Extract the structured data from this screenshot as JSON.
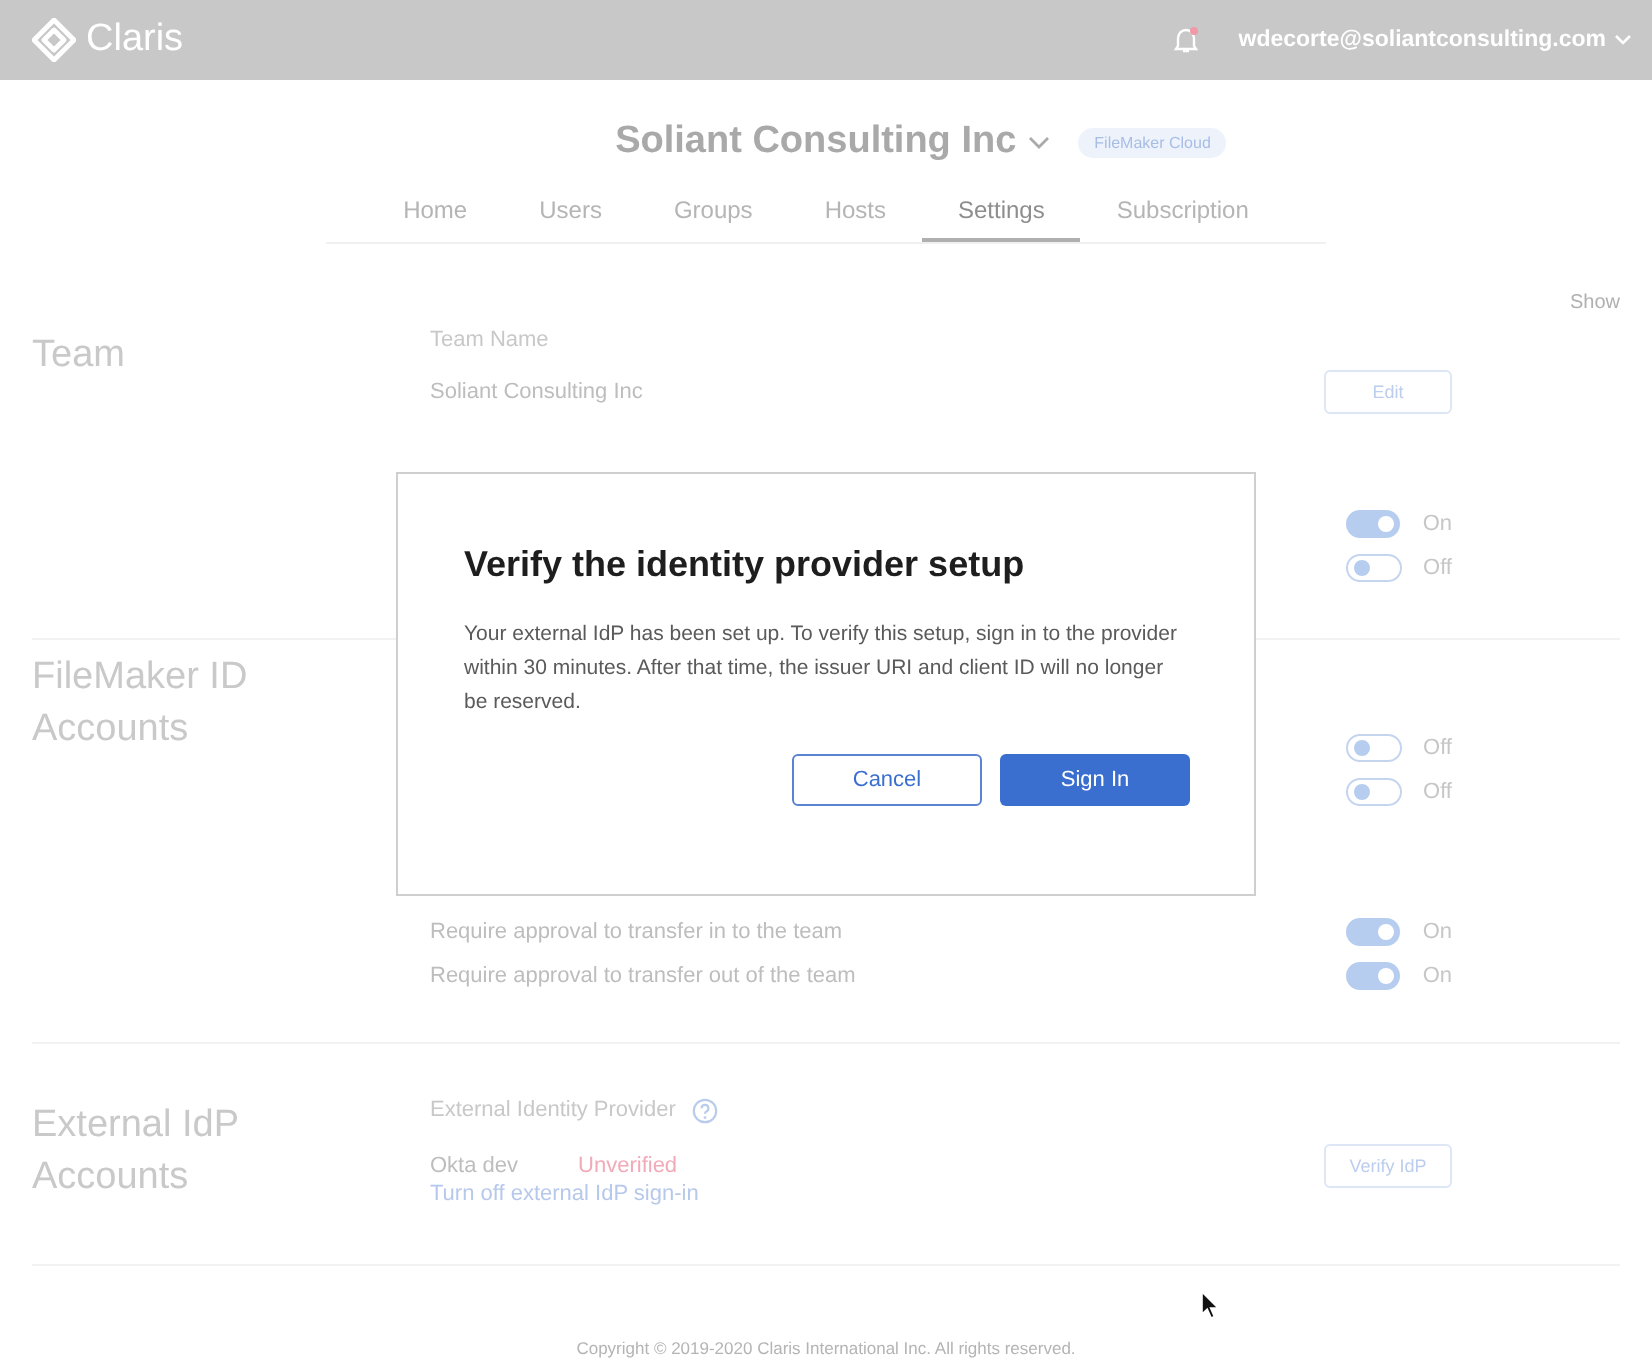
{
  "header": {
    "logo": "Claris",
    "user": "wdecorte@soliantconsulting.com"
  },
  "org": {
    "name": "Soliant Consulting Inc",
    "badge": "FileMaker Cloud"
  },
  "tabs": [
    {
      "label": "Home",
      "selected": false
    },
    {
      "label": "Users",
      "selected": false
    },
    {
      "label": "Groups",
      "selected": false
    },
    {
      "label": "Hosts",
      "selected": false
    },
    {
      "label": "Settings",
      "selected": true
    },
    {
      "label": "Subscription",
      "selected": false
    }
  ],
  "show_link": "Show",
  "sections": [
    {
      "title": "Team",
      "groups": [
        [
          {
            "kind": "label",
            "text": "Team Name"
          },
          {
            "kind": "value",
            "text": "Soliant Consulting Inc",
            "button": "Edit"
          }
        ],
        [
          {
            "kind": "toggle",
            "on": true,
            "state": "On"
          },
          {
            "kind": "toggle",
            "on": false,
            "state": "Off"
          }
        ]
      ]
    },
    {
      "title": "FileMaker ID Accounts",
      "groups": [
        [
          {
            "kind": "toggle",
            "on": false,
            "state": "Off"
          },
          {
            "kind": "toggle",
            "on": false,
            "state": "Off"
          }
        ],
        [
          {
            "kind": "toggle",
            "on": true,
            "state": "On",
            "text": "Require approval to transfer in to the team"
          },
          {
            "kind": "toggle",
            "on": true,
            "state": "On",
            "text": "Require approval to transfer out of the team"
          }
        ]
      ]
    },
    {
      "title": "External IdP Accounts",
      "groups": [
        [
          {
            "kind": "help",
            "text": "External Identity Provider"
          },
          {
            "kind": "status",
            "text": "Okta dev",
            "status": "Unverified",
            "button": "Verify IdP"
          },
          {
            "kind": "link",
            "text": "Turn off external IdP sign-in"
          }
        ]
      ]
    }
  ],
  "footer": "Copyright © 2019-2020 Claris International Inc. All rights reserved.",
  "dialog": {
    "title": "Verify the identity provider setup",
    "body": "Your external IdP has been set up. To verify this setup, sign in to the provider within 30 minutes. After that time, the issuer URI and client ID will no longer be reserved.",
    "buttons": [
      {
        "label": "Cancel",
        "kind": "secondary"
      },
      {
        "label": "Sign In",
        "kind": "primary"
      }
    ]
  }
}
